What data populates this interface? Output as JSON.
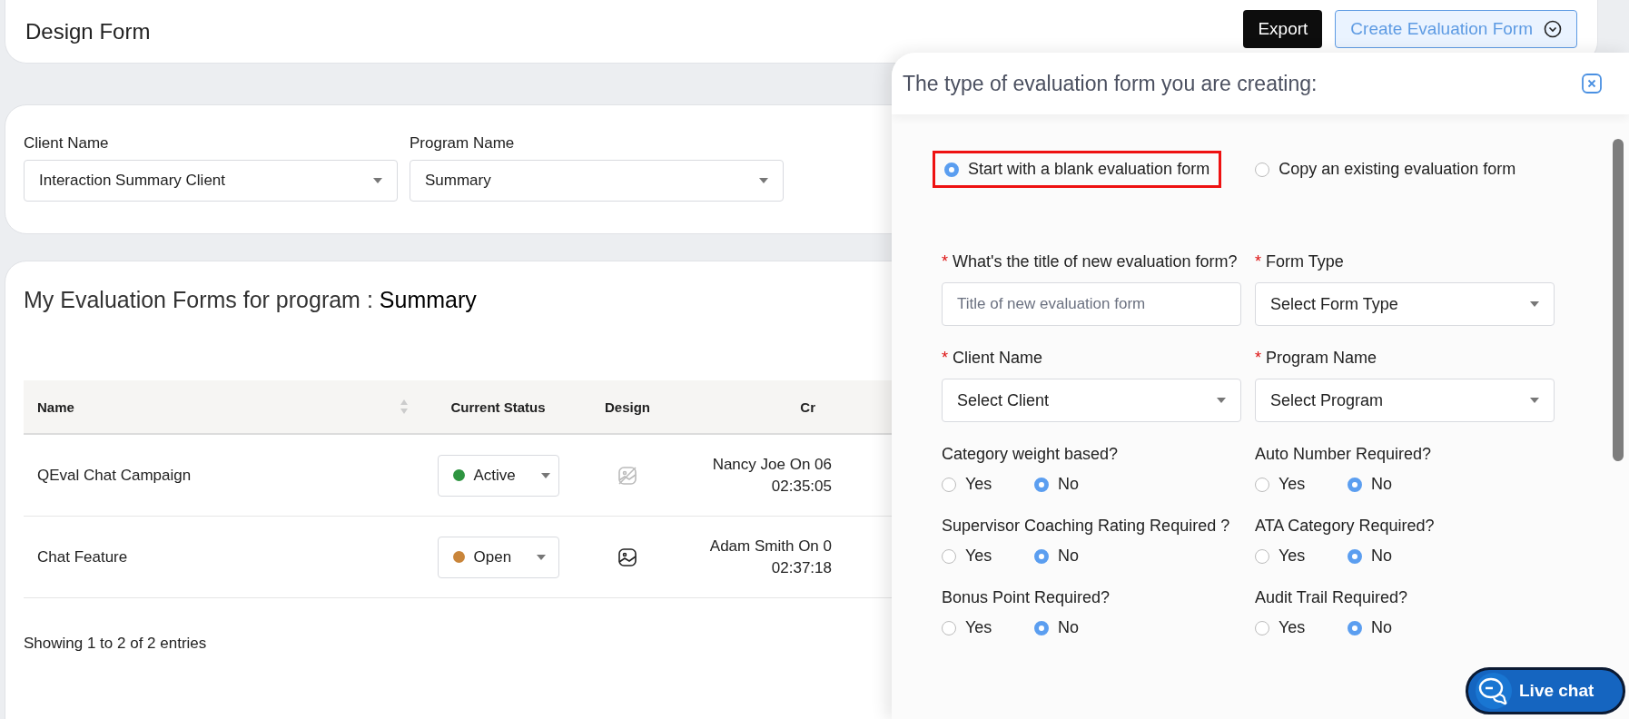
{
  "header": {
    "title": "Design Form",
    "export_button": "Export",
    "create_button": "Create Evaluation Form"
  },
  "filters": [
    {
      "label": "Client Name",
      "value": "Interaction Summary Client"
    },
    {
      "label": "Program Name",
      "value": "Summary"
    }
  ],
  "forms": {
    "title": "My Evaluation Forms for program : **Summary**",
    "columns": [
      "Name",
      "Current Status",
      "Design",
      "Cr"
    ],
    "rows": [
      {
        "name": "QEval Chat Campaign",
        "status": "Active",
        "color": "#2e9440",
        "design_disabled": true,
        "created": [
          "Nancy Joe On 06",
          "02:35:05"
        ]
      },
      {
        "name": "Chat Feature",
        "status": "Open",
        "color": "#c9853a",
        "design_disabled": false,
        "created": [
          "Adam Smith On 0",
          "02:37:18"
        ]
      }
    ],
    "footer": "Showing 1 to 2 of 2 entries"
  },
  "drawer": {
    "title": "The type of evaluation form you are creating:",
    "type_options": [
      {
        "label": "Start with a blank evaluation form",
        "selected": true,
        "highlighted": true
      },
      {
        "label": "Copy an existing evaluation form",
        "selected": false,
        "highlighted": false
      }
    ],
    "fields": [
      {
        "kind": "input",
        "label": "What's the title of new evaluation form?",
        "required_mark": "*",
        "placeholder": "Title of new evaluation form"
      },
      {
        "kind": "select",
        "label": "Form Type",
        "required_mark": "*",
        "placeholder": "Select Form Type"
      },
      {
        "kind": "select",
        "label": "Client Name",
        "required_mark": "*",
        "placeholder": "Select Client"
      },
      {
        "kind": "select",
        "label": "Program Name",
        "required_mark": "*",
        "placeholder": "Select Program"
      },
      {
        "kind": "yesno",
        "label": "Category weight based?",
        "options": [
          {
            "label": "Yes",
            "selected": false
          },
          {
            "label": "No",
            "selected": true
          }
        ]
      },
      {
        "kind": "yesno",
        "label": "Auto Number Required?",
        "options": [
          {
            "label": "Yes",
            "selected": false
          },
          {
            "label": "No",
            "selected": true
          }
        ]
      },
      {
        "kind": "yesno",
        "label": "Supervisor Coaching Rating Required ?",
        "options": [
          {
            "label": "Yes",
            "selected": false
          },
          {
            "label": "No",
            "selected": true
          }
        ]
      },
      {
        "kind": "yesno",
        "label": "ATA Category Required?",
        "options": [
          {
            "label": "Yes",
            "selected": false
          },
          {
            "label": "No",
            "selected": true
          }
        ]
      },
      {
        "kind": "yesno",
        "label": "Bonus Point Required?",
        "options": [
          {
            "label": "Yes",
            "selected": false
          },
          {
            "label": "No",
            "selected": true
          }
        ]
      },
      {
        "kind": "yesno",
        "label": "Audit Trail Required?",
        "options": [
          {
            "label": "Yes",
            "selected": false
          },
          {
            "label": "No",
            "selected": true
          }
        ]
      }
    ]
  },
  "live_chat": "Live chat"
}
